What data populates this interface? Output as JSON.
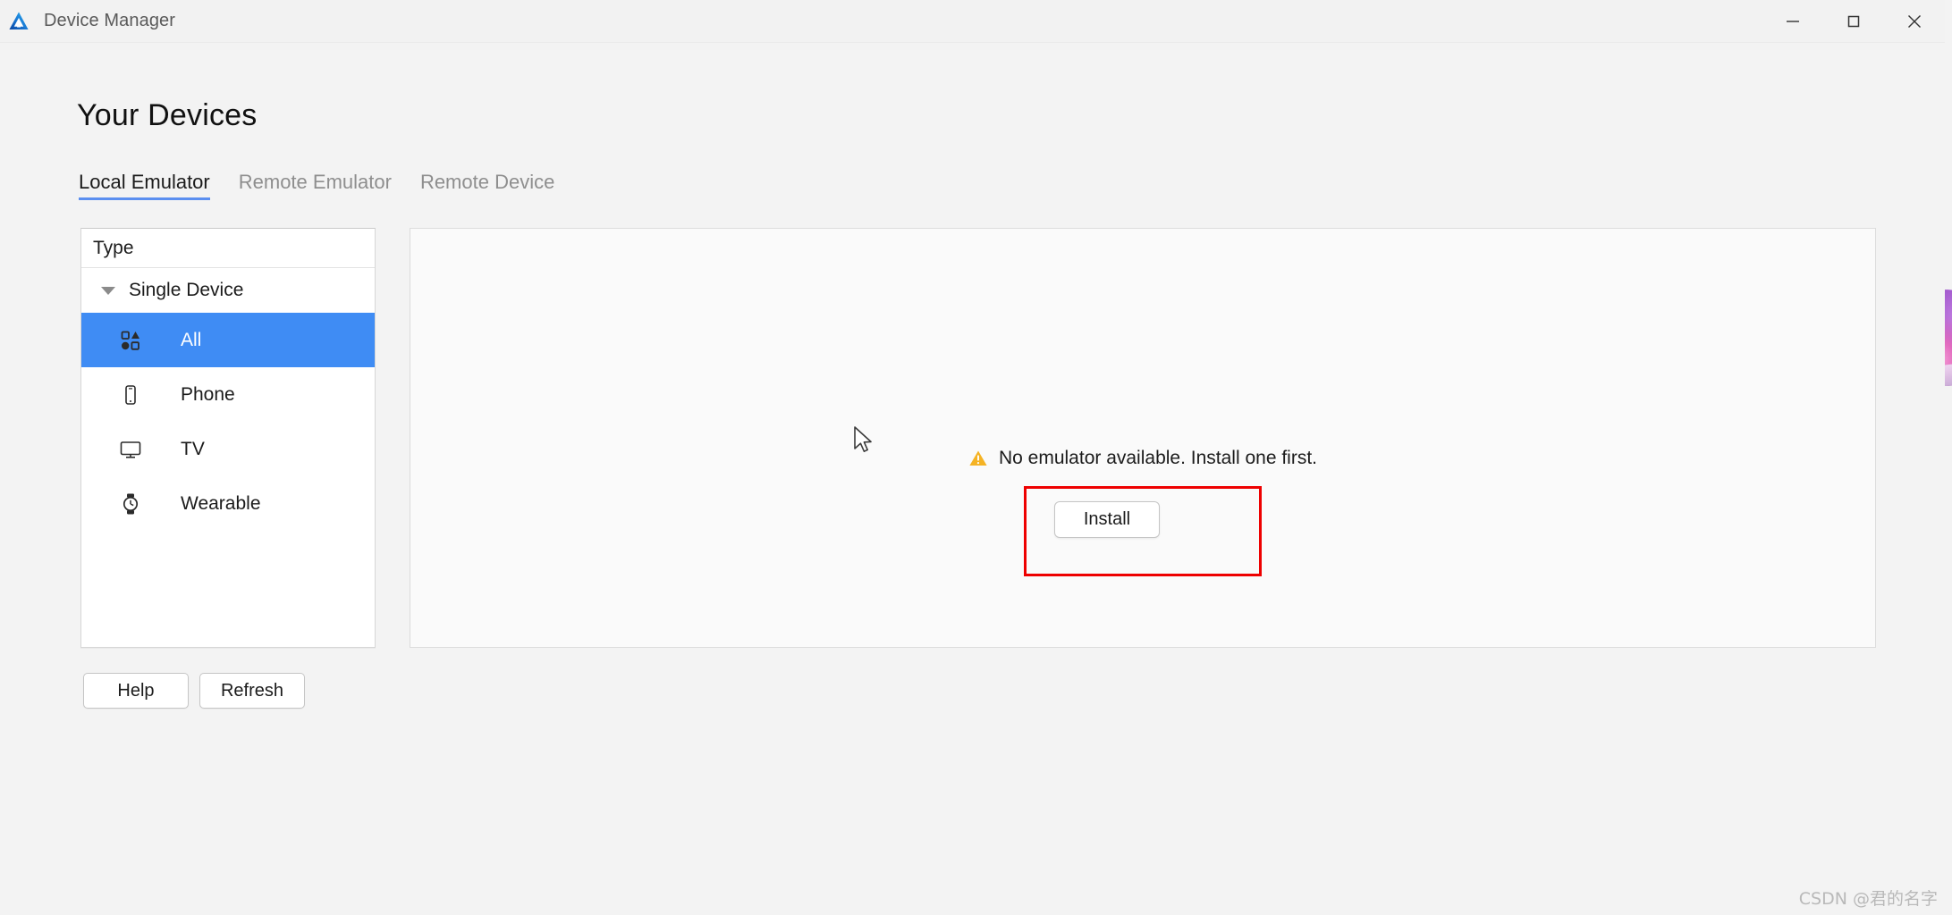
{
  "window": {
    "title": "Device Manager",
    "app_icon": "deveco-logo-icon",
    "controls": {
      "minimize": "minimize-icon",
      "maximize": "maximize-icon",
      "close": "close-icon"
    }
  },
  "page": {
    "title": "Your Devices"
  },
  "tabs": [
    {
      "label": "Local Emulator",
      "active": true
    },
    {
      "label": "Remote Emulator",
      "active": false
    },
    {
      "label": "Remote Device",
      "active": false
    }
  ],
  "sidebar": {
    "header": "Type",
    "group": {
      "label": "Single Device",
      "expanded": true,
      "caret_icon": "chevron-down-icon"
    },
    "items": [
      {
        "label": "All",
        "icon": "grid-shapes-icon",
        "selected": true
      },
      {
        "label": "Phone",
        "icon": "phone-icon",
        "selected": false
      },
      {
        "label": "TV",
        "icon": "tv-icon",
        "selected": false
      },
      {
        "label": "Wearable",
        "icon": "watch-icon",
        "selected": false
      }
    ],
    "selected_color": "#3f8cf4"
  },
  "footer_buttons": {
    "help": "Help",
    "refresh": "Refresh"
  },
  "main": {
    "empty_state": {
      "icon": "warning-triangle-icon",
      "message": "No emulator available. Install one first.",
      "install_label": "Install",
      "highlight_color": "#ee0000"
    }
  },
  "watermark": "CSDN @君的名字"
}
